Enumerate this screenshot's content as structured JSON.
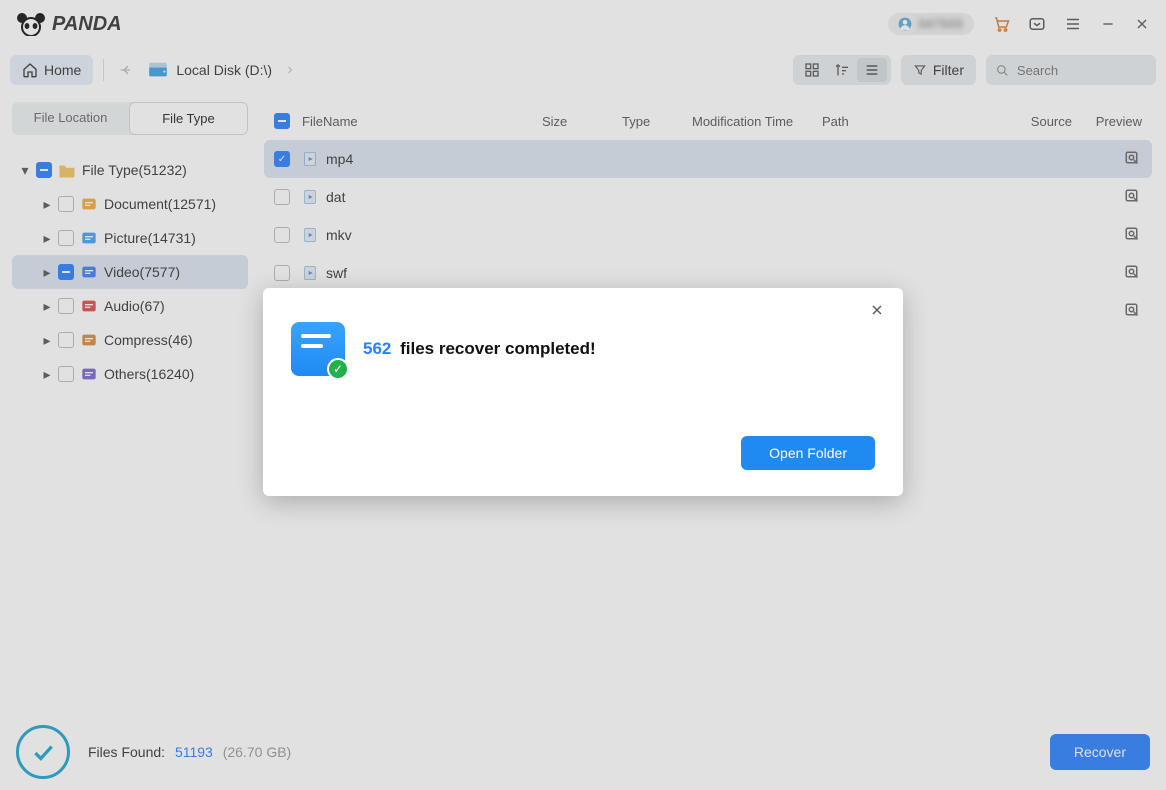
{
  "app": {
    "name": "PANDA"
  },
  "titlebar": {
    "user_obscured": "347505"
  },
  "toolbar": {
    "home": "Home",
    "breadcrumb": "Local Disk (D:\\)",
    "filter": "Filter",
    "search_placeholder": "Search"
  },
  "sidebar": {
    "tabs": {
      "location": "File Location",
      "type": "File Type"
    },
    "root": {
      "label": "File Type(51232)"
    },
    "nodes": [
      {
        "label": "Document(12571)",
        "color": "#f4a93b"
      },
      {
        "label": "Picture(14731)",
        "color": "#3aa3ff"
      },
      {
        "label": "Video(7577)",
        "color": "#3a7dff"
      },
      {
        "label": "Audio(67)",
        "color": "#e04848"
      },
      {
        "label": "Compress(46)",
        "color": "#d78a3a"
      },
      {
        "label": "Others(16240)",
        "color": "#7a61d8"
      }
    ]
  },
  "columns": {
    "name": "FileName",
    "size": "Size",
    "type": "Type",
    "mtime": "Modification Time",
    "path": "Path",
    "source": "Source",
    "preview": "Preview"
  },
  "rows": [
    {
      "name": "mp4",
      "checked": true
    },
    {
      "name": "dat",
      "checked": false
    },
    {
      "name": "mkv",
      "checked": false
    },
    {
      "name": "swf",
      "checked": false
    },
    {
      "name": "",
      "checked": false
    }
  ],
  "footer": {
    "label": "Files Found:",
    "count": "51193",
    "size": "(26.70 GB)",
    "recover_label": "Recover"
  },
  "modal": {
    "count": "562",
    "message": "files recover completed!",
    "open_folder": "Open Folder"
  }
}
